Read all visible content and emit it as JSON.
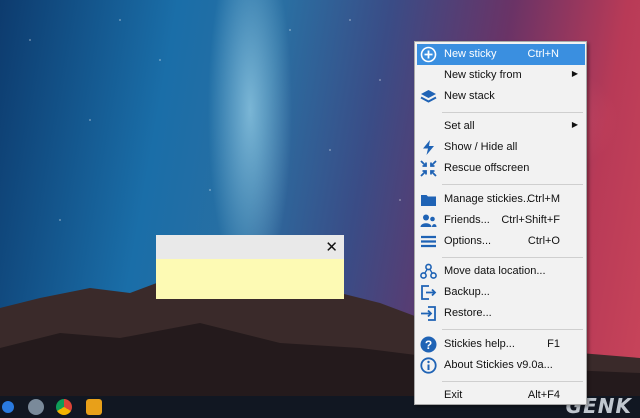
{
  "sticky_note": {
    "close_glyph": "✕"
  },
  "menu": {
    "items": [
      {
        "name": "new-sticky",
        "label": "New sticky",
        "shortcut": "Ctrl+N",
        "icon": "plus-circle-icon"
      },
      {
        "name": "new-sticky-from",
        "label": "New sticky from",
        "shortcut": "",
        "submenu": true,
        "icon": ""
      },
      {
        "name": "new-stack",
        "label": "New stack",
        "shortcut": "",
        "icon": "layers-icon"
      },
      {
        "name": "set-all",
        "label": "Set all",
        "shortcut": "",
        "submenu": true,
        "icon": ""
      },
      {
        "name": "show-hide-all",
        "label": "Show / Hide all",
        "shortcut": "",
        "icon": "lightning-icon"
      },
      {
        "name": "rescue-offscreen",
        "label": "Rescue offscreen",
        "shortcut": "",
        "icon": "collapse-arrows-icon"
      },
      {
        "name": "manage-stickies",
        "label": "Manage stickies...",
        "shortcut": "Ctrl+M",
        "icon": "folder-icon"
      },
      {
        "name": "friends",
        "label": "Friends...",
        "shortcut": "Ctrl+Shift+F",
        "icon": "people-icon"
      },
      {
        "name": "options",
        "label": "Options...",
        "shortcut": "Ctrl+O",
        "icon": "hamburger-icon"
      },
      {
        "name": "move-data-location",
        "label": "Move data location...",
        "shortcut": "",
        "icon": "network-icon"
      },
      {
        "name": "backup",
        "label": "Backup...",
        "shortcut": "",
        "icon": "export-icon"
      },
      {
        "name": "restore",
        "label": "Restore...",
        "shortcut": "",
        "icon": "import-icon"
      },
      {
        "name": "stickies-help",
        "label": "Stickies help...",
        "shortcut": "F1",
        "icon": "question-circle-icon"
      },
      {
        "name": "about",
        "label": "About Stickies v9.0a...",
        "shortcut": "",
        "icon": "info-circle-icon"
      },
      {
        "name": "exit",
        "label": "Exit",
        "shortcut": "Alt+F4",
        "icon": ""
      }
    ]
  },
  "watermark": "GENK",
  "colors": {
    "highlight": "#3a8fe0",
    "icon_blue": "#1f63b5",
    "sticky_yellow": "#fdfab4"
  }
}
